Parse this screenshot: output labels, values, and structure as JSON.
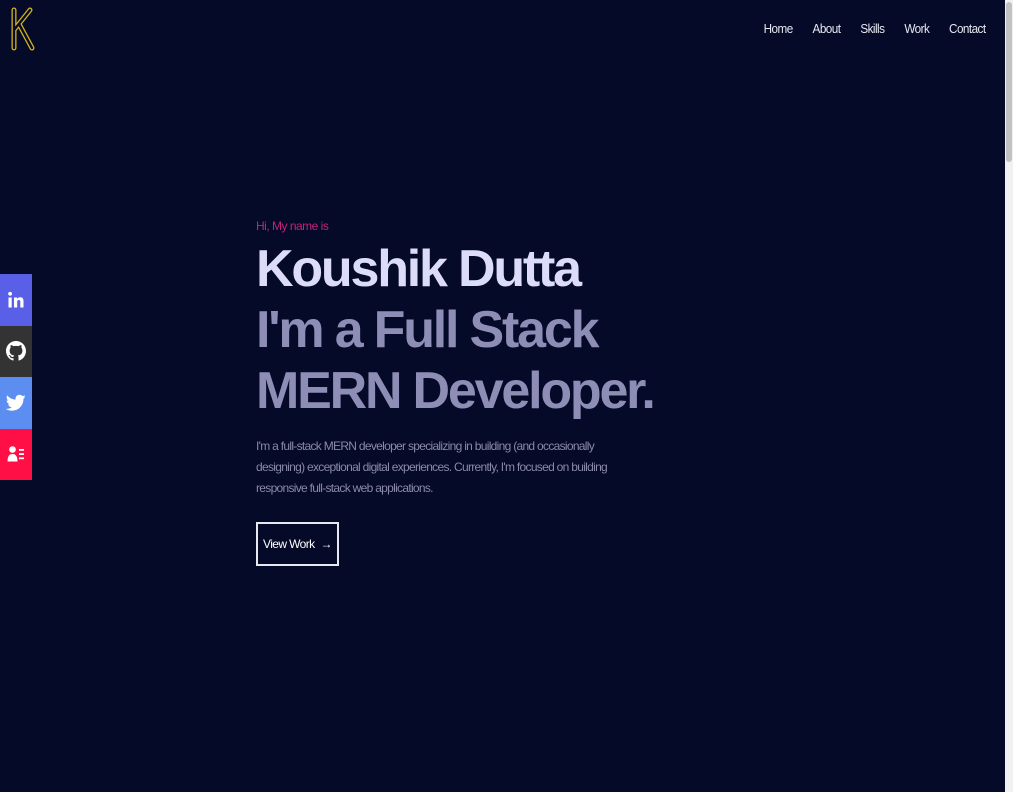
{
  "logo": {
    "letter": "K",
    "icon": "k-logo-icon"
  },
  "nav": {
    "items": [
      "Home",
      "About",
      "Skills",
      "Work",
      "Contact"
    ]
  },
  "social": [
    {
      "name": "linkedin",
      "icon": "linkedin-icon",
      "color": "#5a5fe8"
    },
    {
      "name": "github",
      "icon": "github-icon",
      "color": "#333333"
    },
    {
      "name": "twitter",
      "icon": "twitter-icon",
      "color": "#5b8ef0"
    },
    {
      "name": "resume",
      "icon": "resume-icon",
      "color": "#ff0f45"
    }
  ],
  "hero": {
    "greeting": "Hi, My name is",
    "name": "Koushik Dutta",
    "role": "I'm a Full Stack MERN Developer.",
    "description": "I'm a full-stack MERN developer specializing in building (and occasionally designing) exceptional digital experiences. Currently, I'm focused on building responsive full-stack web applications.",
    "button_label": "View Work",
    "button_arrow": "→"
  },
  "colors": {
    "background": "#050a28",
    "accent": "#c2237b",
    "name": "#dcdcf8",
    "role": "#8d8db6",
    "logo": "#d4b21a"
  }
}
